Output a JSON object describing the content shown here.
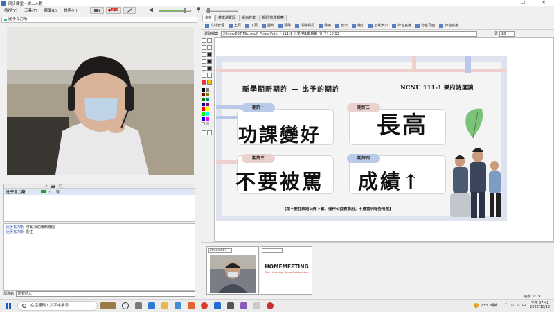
{
  "window": {
    "title": "同步課堂 - 線上人數",
    "controls": [
      "—",
      "☐",
      "✕"
    ]
  },
  "menu": {
    "items": [
      "檢視(V)",
      "工具(T)",
      "版面(L)",
      "說明(H)"
    ],
    "rec_label": "●REC"
  },
  "left": {
    "video_title": "比予瓦力斯",
    "users_headers": [
      "⚠",
      "📷",
      "🗨"
    ],
    "user_row": {
      "name": "比予瓦力斯",
      "status": "有"
    },
    "chat": [
      {
        "who": "比予瓦力斯:",
        "text": "阿賓,我的東西幾個------"
      },
      {
        "who": "比予瓦力斯:",
        "text": "看住"
      }
    ],
    "send_label": "傳送給",
    "send_target": "所有的人"
  },
  "right": {
    "tabs": [
      "白板",
      "共享瀏覽器",
      "桌面共享",
      "視訊/影像觀察"
    ],
    "toolbar": [
      "文件管理",
      "上頁",
      "下頁",
      "圖片",
      "清除",
      "清除標記",
      "橡擦",
      "放大",
      "縮小",
      "正常大小",
      "符合寬度",
      "符合頁面",
      "符合寬度"
    ],
    "file_label": "選取檔案",
    "file_name": "20nom007 Microsoft PowerPoint - 111-1 上學 第1期期期 (比予) 10.13",
    "page_label": "頁",
    "page_value": "28"
  },
  "slide": {
    "title": "新學期新期許 — 比予的期許",
    "subtitle": "NCNU 111-1 樂府詩選讀",
    "cards": [
      {
        "label": "期許一",
        "text": "功課變好"
      },
      {
        "label": "期許二",
        "text": "長高"
      },
      {
        "label": "期許三",
        "text": "不要被罵"
      },
      {
        "label": "期許四",
        "text": "成績↑"
      }
    ],
    "footer": "【請不要在網路公開下載，僅作公益教學用，不應當利報告用途】"
  },
  "thumbs": {
    "first_select": "20nom007",
    "logo": "HOMEMEETING",
    "logo_sub": "Team Learning. Group Collaboration"
  },
  "status": {
    "zoom": "縮放: 1:19"
  },
  "taskbar": {
    "search_placeholder": "在這裡輸入文字來搜尋",
    "weather": "23°C 晴朗",
    "time": "下午 07:42",
    "date": "2022/10/13"
  },
  "colors": {
    "slide_bg": "#dfe3f0",
    "pill_blue": "#b9cbe8",
    "pill_pink": "#ecd2cf",
    "accent": "#1a5fb4"
  }
}
